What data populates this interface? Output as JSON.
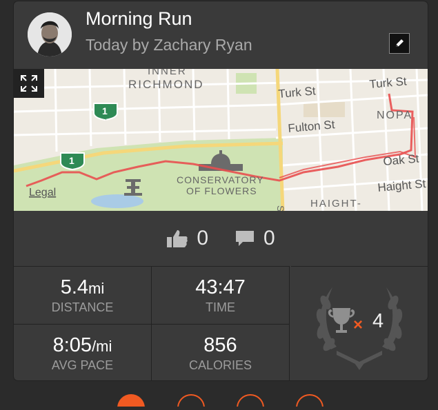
{
  "activity": {
    "title": "Morning Run",
    "subtitle": "Today by Zachary Ryan"
  },
  "map": {
    "labels": {
      "inner_richmond_1": "INNER",
      "inner_richmond_2": "RICHMOND",
      "turk_st_1": "Turk St",
      "turk_st_2": "Turk St",
      "fulton_st": "Fulton St",
      "nopa": "NOPA",
      "oak_st": "Oak St",
      "haight_st": "Haight St",
      "conservatory_1": "CONSERVATORY",
      "conservatory_2": "OF FLOWERS",
      "haight_district": "HAIGHT-",
      "side_street": "St",
      "highway_1": "1",
      "highway_2": "1",
      "legal": "Legal"
    },
    "route_color": "#e84f4f"
  },
  "social": {
    "kudos_count": "0",
    "comments_count": "0"
  },
  "stats": {
    "distance": {
      "value": "5.4",
      "unit": "mi",
      "label": "DISTANCE"
    },
    "time": {
      "value": "43:47",
      "label": "TIME"
    },
    "pace": {
      "value": "8:05",
      "unit": "/mi",
      "label": "AVG PACE"
    },
    "calories": {
      "value": "856",
      "label": "CALORIES"
    }
  },
  "achievements": {
    "multiplier": "×",
    "count": "4"
  },
  "colors": {
    "accent": "#f05a22",
    "card_bg": "#3a3a3a",
    "page_bg": "#2b2b2b"
  }
}
